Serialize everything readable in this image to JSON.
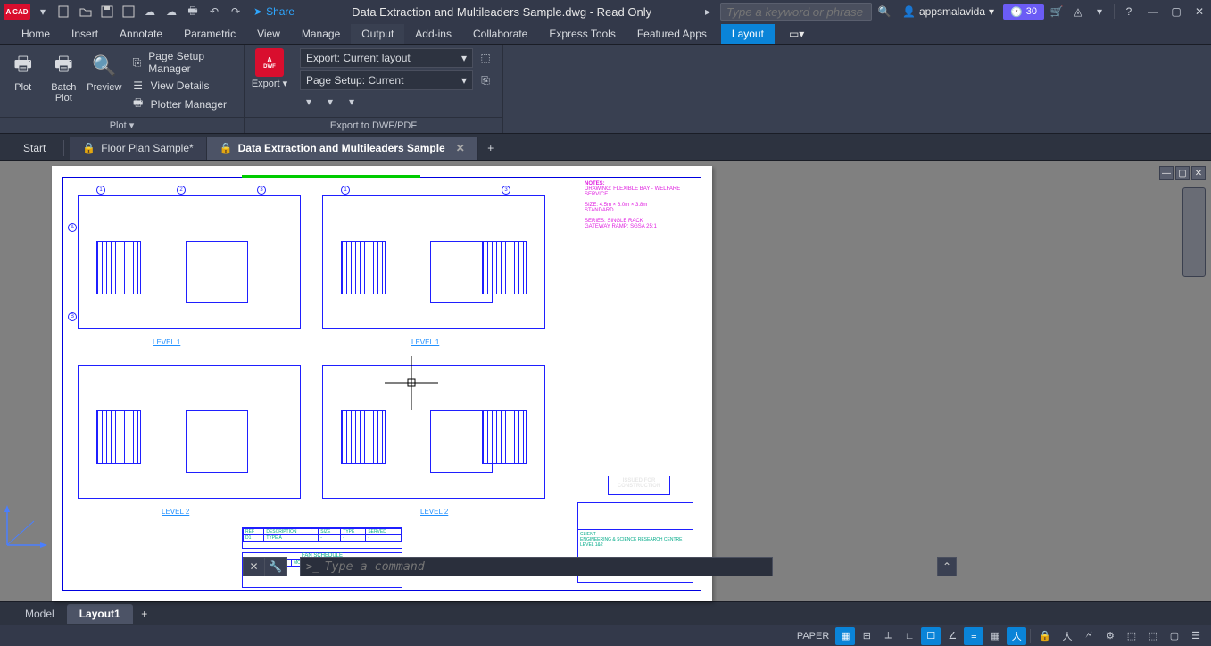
{
  "titlebar": {
    "app_logo": "A CAD",
    "share": "Share",
    "document_title": "Data Extraction and Multileaders Sample.dwg - Read Only",
    "search_placeholder": "Type a keyword or phrase",
    "username": "appsmalavida",
    "trial_days": "30"
  },
  "ribbon_tabs": [
    "Home",
    "Insert",
    "Annotate",
    "Parametric",
    "View",
    "Manage",
    "Output",
    "Add-ins",
    "Collaborate",
    "Express Tools",
    "Featured Apps",
    "Layout"
  ],
  "ribbon_active": "Output",
  "ribbon": {
    "plot": {
      "plot": "Plot",
      "batch_plot": "Batch\nPlot",
      "preview": "Preview",
      "page_setup_manager": "Page Setup Manager",
      "view_details": "View Details",
      "plotter_manager": "Plotter Manager",
      "panel_title": "Plot"
    },
    "export": {
      "export": "Export",
      "export_combo": "Export: Current layout",
      "page_setup_combo": "Page Setup: Current",
      "panel_title": "Export to DWF/PDF"
    }
  },
  "file_tabs": {
    "start": "Start",
    "items": [
      {
        "label": "Floor Plan Sample*",
        "locked": true,
        "active": false
      },
      {
        "label": "Data Extraction and Multileaders Sample",
        "locked": true,
        "active": true
      }
    ]
  },
  "drawing": {
    "levels": [
      "LEVEL 1",
      "LEVEL 1",
      "LEVEL 2",
      "LEVEL 2"
    ],
    "notes_header": "NOTES:",
    "issued": "ISSUED FOR\nCONSTRUCTION",
    "title_block_client": "CLIENT\nENGINEERING & SCIENCE RESEARCH CENTRE\nLEVEL 1&2",
    "schedule_title": "FAN SCHEDULE"
  },
  "commandline": {
    "placeholder": "Type a command"
  },
  "layout_tabs": {
    "model": "Model",
    "layout1": "Layout1"
  },
  "statusbar": {
    "paper": "PAPER"
  }
}
